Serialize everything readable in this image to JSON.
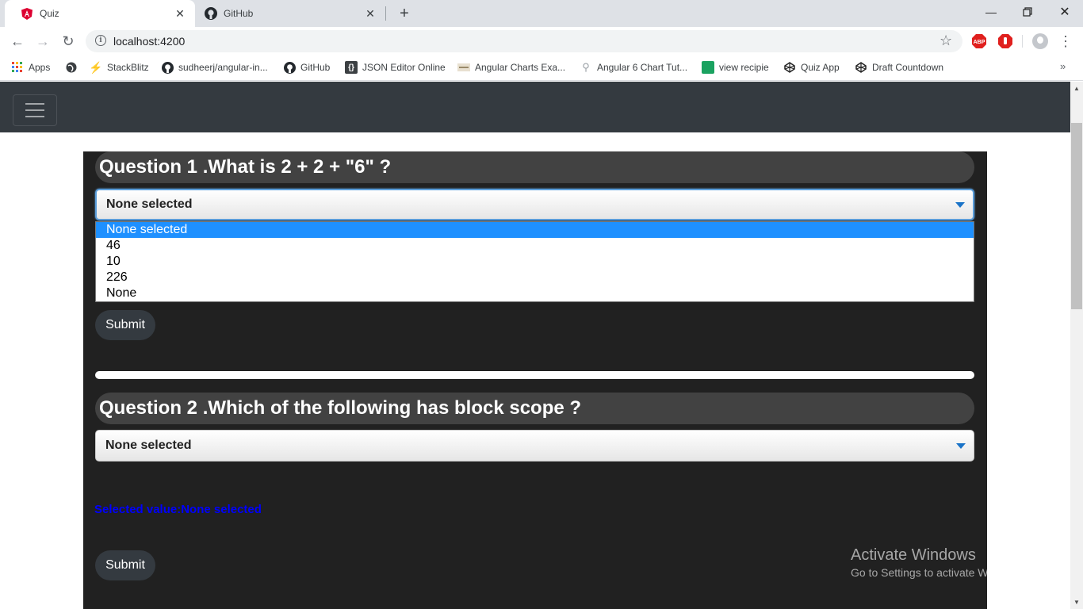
{
  "browser": {
    "tabs": [
      {
        "title": "Quiz",
        "icon": "angular-icon",
        "active": true
      },
      {
        "title": "GitHub",
        "icon": "github-icon",
        "active": false
      }
    ],
    "url": "localhost:4200",
    "bookmarks": [
      {
        "label": "Apps",
        "icon": "apps-grid-icon"
      },
      {
        "label": "",
        "icon": "globe-icon"
      },
      {
        "label": "StackBlitz",
        "icon": "lightning-icon"
      },
      {
        "label": "sudheerj/angular-in...",
        "icon": "github-icon"
      },
      {
        "label": "GitHub",
        "icon": "github-icon"
      },
      {
        "label": "JSON Editor Online",
        "icon": "braces-icon"
      },
      {
        "label": "Angular Charts Exa...",
        "icon": "page-icon"
      },
      {
        "label": "Angular 6 Chart Tut...",
        "icon": "link-icon"
      },
      {
        "label": "view recipie",
        "icon": "site-icon"
      },
      {
        "label": "Quiz App",
        "icon": "codepen-icon"
      },
      {
        "label": "Draft Countdown",
        "icon": "codepen-icon"
      }
    ],
    "extensions": [
      "ABP",
      "stop-icon",
      "profile-icon"
    ]
  },
  "quiz": {
    "questions": [
      {
        "title": "Question 1 .What is 2 + 2 + \"6\" ?",
        "selected": "None selected",
        "options": [
          "None selected",
          "46",
          "10",
          "226",
          "None"
        ],
        "submit_label": "Submit"
      },
      {
        "title": "Question 2 .Which of the following has block scope ?",
        "selected": "None selected",
        "selected_value_text": "Selected value:None selected",
        "submit_label": "Submit"
      }
    ]
  },
  "watermark": {
    "title": "Activate Windows",
    "subtitle": "Go to Settings to activate Windows."
  },
  "colors": {
    "navbar": "#343a40",
    "card": "#212121",
    "question_bar": "#424242",
    "dropdown_highlight": "#1e90ff",
    "selected_value": "#0000ff"
  }
}
